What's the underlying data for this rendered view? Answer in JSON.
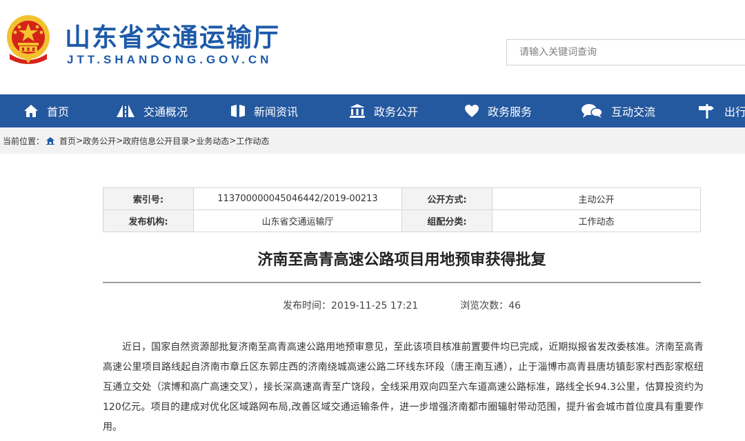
{
  "header": {
    "site_title": "山东省交通运输厅",
    "site_domain": "JTT.SHANDONG.GOV.CN",
    "search_placeholder": "请输入关键词查询"
  },
  "nav": {
    "items": [
      {
        "label": "首页",
        "icon": "home-icon"
      },
      {
        "label": "交通概况",
        "icon": "road-icon"
      },
      {
        "label": "新闻资讯",
        "icon": "newspaper-icon"
      },
      {
        "label": "政务公开",
        "icon": "building-icon"
      },
      {
        "label": "政务服务",
        "icon": "heart-icon"
      },
      {
        "label": "互动交流",
        "icon": "chat-bubbles-icon"
      },
      {
        "label": "出行",
        "icon": "signpost-icon"
      }
    ],
    "background": "#24589f"
  },
  "breadcrumb": {
    "label": "当前位置：",
    "path": [
      "首页",
      "政务公开",
      "政府信息公开目录",
      "业务动态",
      "工作动态"
    ],
    "separator": ">"
  },
  "meta_table": {
    "index_label": "索引号:",
    "index_value": "113700000045046442/2019-00213",
    "open_mode_label": "公开方式:",
    "open_mode_value": "主动公开",
    "publisher_label": "发布机构:",
    "publisher_value": "山东省交通运输厅",
    "category_label": "组配分类:",
    "category_value": "工作动态"
  },
  "article": {
    "title": "济南至高青高速公路项目用地预审获得批复",
    "publish_time_label": "发布时间：",
    "publish_time": "2019-11-25 17:21",
    "views_label": "浏览次数：",
    "views": "46",
    "body": "近日，国家自然资源部批复济南至高青高速公路用地预审意见，至此该项目核准前置要件均已完成，近期拟报省发改委核准。济南至高青高速公里项目路线起自济南市章丘区东郭庄西的济南绕城高速公路二环线东环段（唐王南互通），止于淄博市高青县唐坊镇彭家村西彭家枢纽互通立交处（滨博和高广高速交叉），接长深高速高青至广饶段，全线采用双向四至六车道高速公路标准，路线全长94.3公里，估算投资约为120亿元。项目的建成对优化区域路网布局,改善区域交通运输条件，进一步增强济南都市圈辐射带动范围，提升省会城市首位度具有重要作用。"
  },
  "colors": {
    "brand_blue": "#1d5aa8",
    "emblem_red": "#d6231a",
    "emblem_gold": "#f2c12e"
  }
}
